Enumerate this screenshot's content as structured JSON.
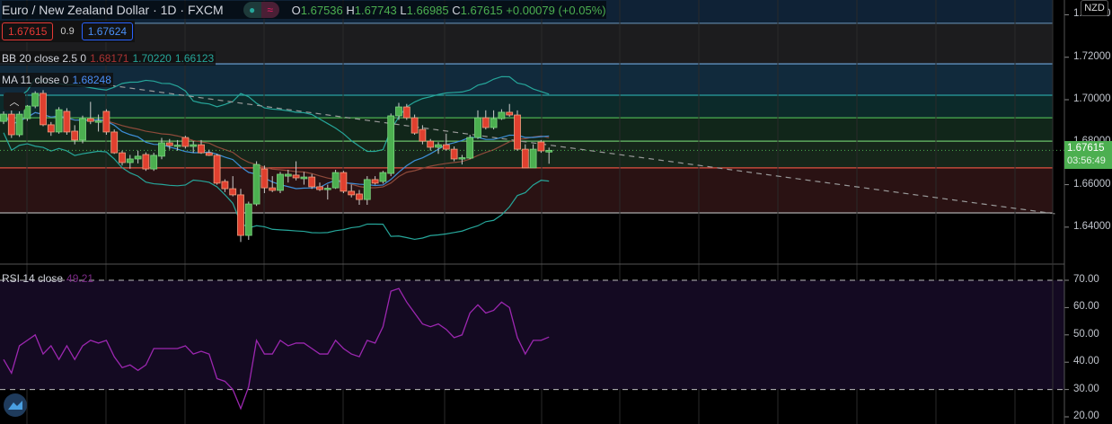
{
  "header": {
    "symbol_title": "Euro / New Zealand Dollar · 1D · FXCM",
    "ohlc": {
      "o_label": "O",
      "o": "1.67536",
      "h_label": "H",
      "h": "1.67743",
      "l_label": "L",
      "l": "1.66985",
      "c_label": "C",
      "c": "1.67615",
      "change": "+0.00079 (+0.05%)"
    }
  },
  "quote": {
    "sell": "1.67615",
    "spread": "0.9",
    "buy": "1.67624"
  },
  "indicators": {
    "bb": {
      "label": "BB 20 close 2.5 0",
      "basis": "1.68171",
      "upper": "1.70220",
      "lower": "1.66123"
    },
    "ma": {
      "label": "MA 11 close 0",
      "value": "1.68248"
    },
    "rsi": {
      "label": "RSI 14 close",
      "value": "49.21"
    }
  },
  "price_axis": {
    "currency": "NZD",
    "ticks": [
      "1.74000",
      "1.72000",
      "1.70000",
      "1.68000",
      "1.66000",
      "1.64000"
    ],
    "last_price": "1.67615",
    "countdown": "03:56:49"
  },
  "rsi_axis": {
    "ticks": [
      "70.00",
      "60.00",
      "50.00",
      "40.00",
      "30.00",
      "20.00"
    ]
  },
  "colors": {
    "up": "#4caf50",
    "down": "#e0402f",
    "bb_band": "#26a69a",
    "bb_basis": "#8d4a3a",
    "ma": "#3d8fd9",
    "rsi": "#9c27b0"
  },
  "chart_data": {
    "type": "candlestick",
    "title": "Euro / New Zealand Dollar 1D",
    "ylim": [
      1.628,
      1.745
    ],
    "levels": [
      1.736,
      1.7169,
      1.7021,
      1.6915,
      1.6805,
      1.6679,
      1.6467
    ],
    "trendline": {
      "from": [
        11,
        1.708
      ],
      "to": [
        133,
        1.6463
      ]
    },
    "candles": [
      [
        1.6898,
        1.6945,
        1.6885,
        1.6932
      ],
      [
        1.6932,
        1.695,
        1.682,
        1.6835
      ],
      [
        1.6835,
        1.6945,
        1.6825,
        1.6932
      ],
      [
        1.6911,
        1.6975,
        1.69,
        1.697
      ],
      [
        1.697,
        1.704,
        1.696,
        1.703
      ],
      [
        1.703,
        1.7045,
        1.6875,
        1.6882
      ],
      [
        1.6882,
        1.6895,
        1.683,
        1.6848
      ],
      [
        1.6848,
        1.6965,
        1.684,
        1.6953
      ],
      [
        1.6945,
        1.696,
        1.6835,
        1.6848
      ],
      [
        1.6852,
        1.688,
        1.679,
        1.681
      ],
      [
        1.681,
        1.6925,
        1.6795,
        1.6911
      ],
      [
        1.6911,
        1.699,
        1.6885,
        1.6898
      ],
      [
        1.6898,
        1.693,
        1.685,
        1.69
      ],
      [
        1.6945,
        1.6955,
        1.6835,
        1.6848
      ],
      [
        1.6848,
        1.686,
        1.6745,
        1.675
      ],
      [
        1.675,
        1.676,
        1.669,
        1.6704
      ],
      [
        1.6704,
        1.674,
        1.6675,
        1.6721
      ],
      [
        1.6721,
        1.676,
        1.67,
        1.6734
      ],
      [
        1.6742,
        1.6752,
        1.6665,
        1.6674
      ],
      [
        1.6674,
        1.675,
        1.6665,
        1.6738
      ],
      [
        1.6734,
        1.682,
        1.672,
        1.6797
      ],
      [
        1.6797,
        1.6815,
        1.6765,
        1.6784
      ],
      [
        1.6784,
        1.681,
        1.676,
        1.6786
      ],
      [
        1.6822,
        1.683,
        1.677,
        1.678
      ],
      [
        1.678,
        1.6805,
        1.675,
        1.6788
      ],
      [
        1.6788,
        1.681,
        1.6745,
        1.675
      ],
      [
        1.675,
        1.6765,
        1.6735,
        1.6738
      ],
      [
        1.6738,
        1.6745,
        1.66,
        1.6607
      ],
      [
        1.6615,
        1.6625,
        1.6565,
        1.6581
      ],
      [
        1.6581,
        1.664,
        1.6545,
        1.6552
      ],
      [
        1.6552,
        1.658,
        1.633,
        1.6361
      ],
      [
        1.6361,
        1.652,
        1.634,
        1.6509
      ],
      [
        1.6509,
        1.671,
        1.65,
        1.6695
      ],
      [
        1.6674,
        1.669,
        1.656,
        1.6585
      ],
      [
        1.6585,
        1.664,
        1.6565,
        1.6573
      ],
      [
        1.6573,
        1.666,
        1.656,
        1.6649
      ],
      [
        1.664,
        1.667,
        1.661,
        1.6649
      ],
      [
        1.6645,
        1.671,
        1.662,
        1.6632
      ],
      [
        1.6628,
        1.666,
        1.66,
        1.6636
      ],
      [
        1.6636,
        1.665,
        1.658,
        1.659
      ],
      [
        1.659,
        1.661,
        1.657,
        1.6577
      ],
      [
        1.6581,
        1.66,
        1.653,
        1.6583
      ],
      [
        1.6585,
        1.667,
        1.658,
        1.6657
      ],
      [
        1.6657,
        1.6665,
        1.656,
        1.6569
      ],
      [
        1.6569,
        1.66,
        1.654,
        1.6552
      ],
      [
        1.6556,
        1.6575,
        1.6505,
        1.653
      ],
      [
        1.653,
        1.664,
        1.6505,
        1.6624
      ],
      [
        1.6624,
        1.664,
        1.66,
        1.6607
      ],
      [
        1.6615,
        1.6665,
        1.6605,
        1.6657
      ],
      [
        1.6653,
        1.6935,
        1.664,
        1.6924
      ],
      [
        1.6924,
        1.6985,
        1.6905,
        1.6966
      ],
      [
        1.6966,
        1.698,
        1.6905,
        1.6915
      ],
      [
        1.6915,
        1.693,
        1.6835,
        1.6843
      ],
      [
        1.686,
        1.688,
        1.679,
        1.6805
      ],
      [
        1.6805,
        1.6815,
        1.676,
        1.6776
      ],
      [
        1.6776,
        1.68,
        1.6745,
        1.6788
      ],
      [
        1.6788,
        1.684,
        1.676,
        1.6767
      ],
      [
        1.6767,
        1.678,
        1.671,
        1.6721
      ],
      [
        1.6725,
        1.674,
        1.6695,
        1.6727
      ],
      [
        1.6725,
        1.6835,
        1.672,
        1.6822
      ],
      [
        1.6822,
        1.695,
        1.6815,
        1.6915
      ],
      [
        1.6915,
        1.695,
        1.686,
        1.6869
      ],
      [
        1.6869,
        1.695,
        1.686,
        1.6911
      ],
      [
        1.6911,
        1.6955,
        1.6905,
        1.6941
      ],
      [
        1.6941,
        1.698,
        1.692,
        1.6928
      ],
      [
        1.6928,
        1.695,
        1.676,
        1.6767
      ],
      [
        1.6767,
        1.679,
        1.6679,
        1.6679
      ],
      [
        1.6679,
        1.679,
        1.6679,
        1.6767
      ],
      [
        1.6801,
        1.681,
        1.675,
        1.6759
      ],
      [
        1.67536,
        1.67743,
        1.66985,
        1.67615
      ]
    ],
    "rsi": [
      41,
      36,
      46,
      48,
      50,
      43,
      46,
      41,
      46,
      41,
      46,
      48,
      47,
      48,
      42,
      38,
      39,
      37,
      39,
      45,
      45,
      45,
      45,
      46,
      43,
      44,
      43,
      34,
      33,
      30,
      23,
      31,
      48,
      43,
      43,
      48,
      46,
      47,
      47,
      45,
      43,
      43,
      48,
      45,
      43,
      42,
      48,
      47,
      53,
      66,
      67,
      62,
      58,
      54,
      53,
      54,
      52,
      49,
      50,
      58,
      61,
      58,
      59,
      62,
      60,
      49,
      43,
      48,
      48,
      49.21
    ],
    "rsi_ylim": [
      20,
      70
    ]
  }
}
